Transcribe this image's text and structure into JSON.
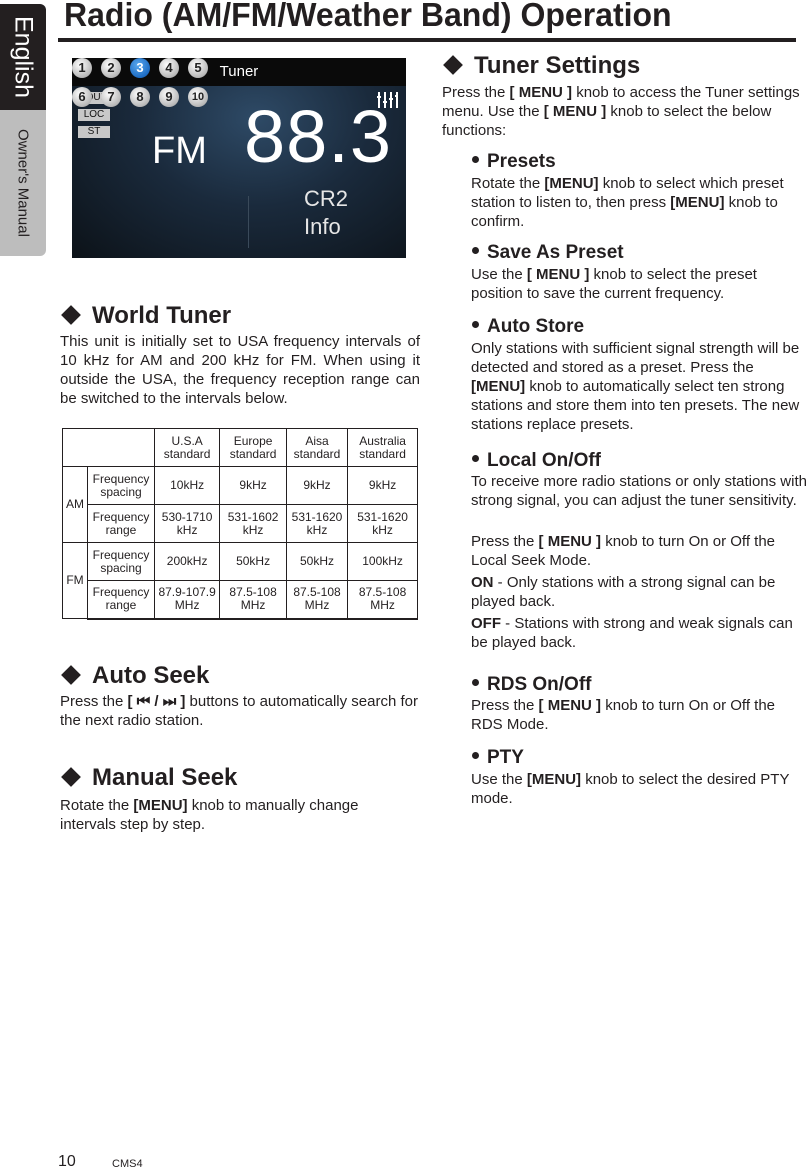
{
  "side_tab": {
    "language": "English",
    "manual": "Owner's Manual"
  },
  "page_title": "Radio (AM/FM/Weather Band) Operation",
  "tuner_screen": {
    "title": "Tuner",
    "badges": [
      "LOUD",
      "LOC",
      "ST"
    ],
    "band": "FM",
    "frequency": "88.3",
    "eq_icon": "equalizer-icon",
    "presets": [
      "1",
      "2",
      "3",
      "4",
      "5",
      "6",
      "7",
      "8",
      "9",
      "10"
    ],
    "active_preset": "3",
    "station_name": "CR2",
    "info_label": "Info",
    "active_color": "#1d6cc4"
  },
  "world_tuner": {
    "heading": "World Tuner",
    "body": "This unit is initially set to USA frequency intervals of 10 kHz for AM and 200 kHz for FM. When using it outside the USA, the frequency reception range can be switched to the intervals below.",
    "table": {
      "headers": [
        "U.S.A standard",
        "Europe standard",
        "Aisa standard",
        "Australia standard"
      ],
      "bands": [
        {
          "band": "AM",
          "rows": [
            {
              "label": "Frequency spacing",
              "values": [
                "10kHz",
                "9kHz",
                "9kHz",
                "9kHz"
              ]
            },
            {
              "label": "Frequency range",
              "values": [
                "530-1710 kHz",
                "531-1602 kHz",
                "531-1620 kHz",
                "531-1620 kHz"
              ]
            }
          ]
        },
        {
          "band": "FM",
          "rows": [
            {
              "label": "Frequency spacing",
              "values": [
                "200kHz",
                "50kHz",
                "50kHz",
                "100kHz"
              ]
            },
            {
              "label": "Frequency range",
              "values": [
                "87.9-107.9 MHz",
                "87.5-108 MHz",
                "87.5-108 MHz",
                "87.5-108 MHz"
              ]
            }
          ]
        }
      ]
    }
  },
  "auto_seek": {
    "heading": "Auto Seek",
    "body_pre": "Press the ",
    "body_key": "[ ⏮ / ⏭ ]",
    "body_post": " buttons to automatically search for the next radio station."
  },
  "manual_seek": {
    "heading": "Manual Seek",
    "body_pre": "Rotate the ",
    "body_key": "[MENU]",
    "body_post": " knob to manually change intervals step by step."
  },
  "tuner_settings": {
    "heading": "Tuner Settings",
    "intro": {
      "a": "Press the ",
      "k1": "[ MENU ]",
      "b": " knob to access the Tuner settings menu. Use the ",
      "k2": "[ MENU ]",
      "c": " knob to select the below functions:"
    },
    "items": [
      {
        "title": "Presets",
        "a": "Rotate the ",
        "k1": "[MENU]",
        "b": " knob to select which preset station to listen to, then press ",
        "k2": "[MENU]",
        "c": " knob to confirm."
      },
      {
        "title": "Save As Preset",
        "a": "Use the ",
        "k1": "[ MENU ]",
        "b": " knob to select the preset position to save the current frequency."
      },
      {
        "title": "Auto Store",
        "a": "Only stations with sufficient signal strength will be detected and stored as a preset. Press the ",
        "k1": "[MENU]",
        "b": " knob to automatically select ten strong stations and store them into ten presets. The new stations replace presets."
      },
      {
        "title": "Local On/Off",
        "a": "To receive more radio stations or only stations with strong signal, you can adjust the tuner sensitivity.",
        "p2a": "Press the ",
        "p2k": "[ MENU ]",
        "p2b": " knob to turn On or Off the Local Seek Mode.",
        "on_k": "ON",
        "on_t": " - Only stations with a strong signal can be played back.",
        "off_k": "OFF",
        "off_t": " - Stations with strong and weak signals can be played back."
      },
      {
        "title": "RDS On/Off",
        "a": "Press the ",
        "k1": "[ MENU ]",
        "b": " knob to turn On or Off the RDS Mode."
      },
      {
        "title": "PTY",
        "a": "Use the ",
        "k1": "[MENU]",
        "b": " knob to select the desired PTY mode."
      }
    ]
  },
  "footer": {
    "page_number": "10",
    "model": "CMS4"
  }
}
